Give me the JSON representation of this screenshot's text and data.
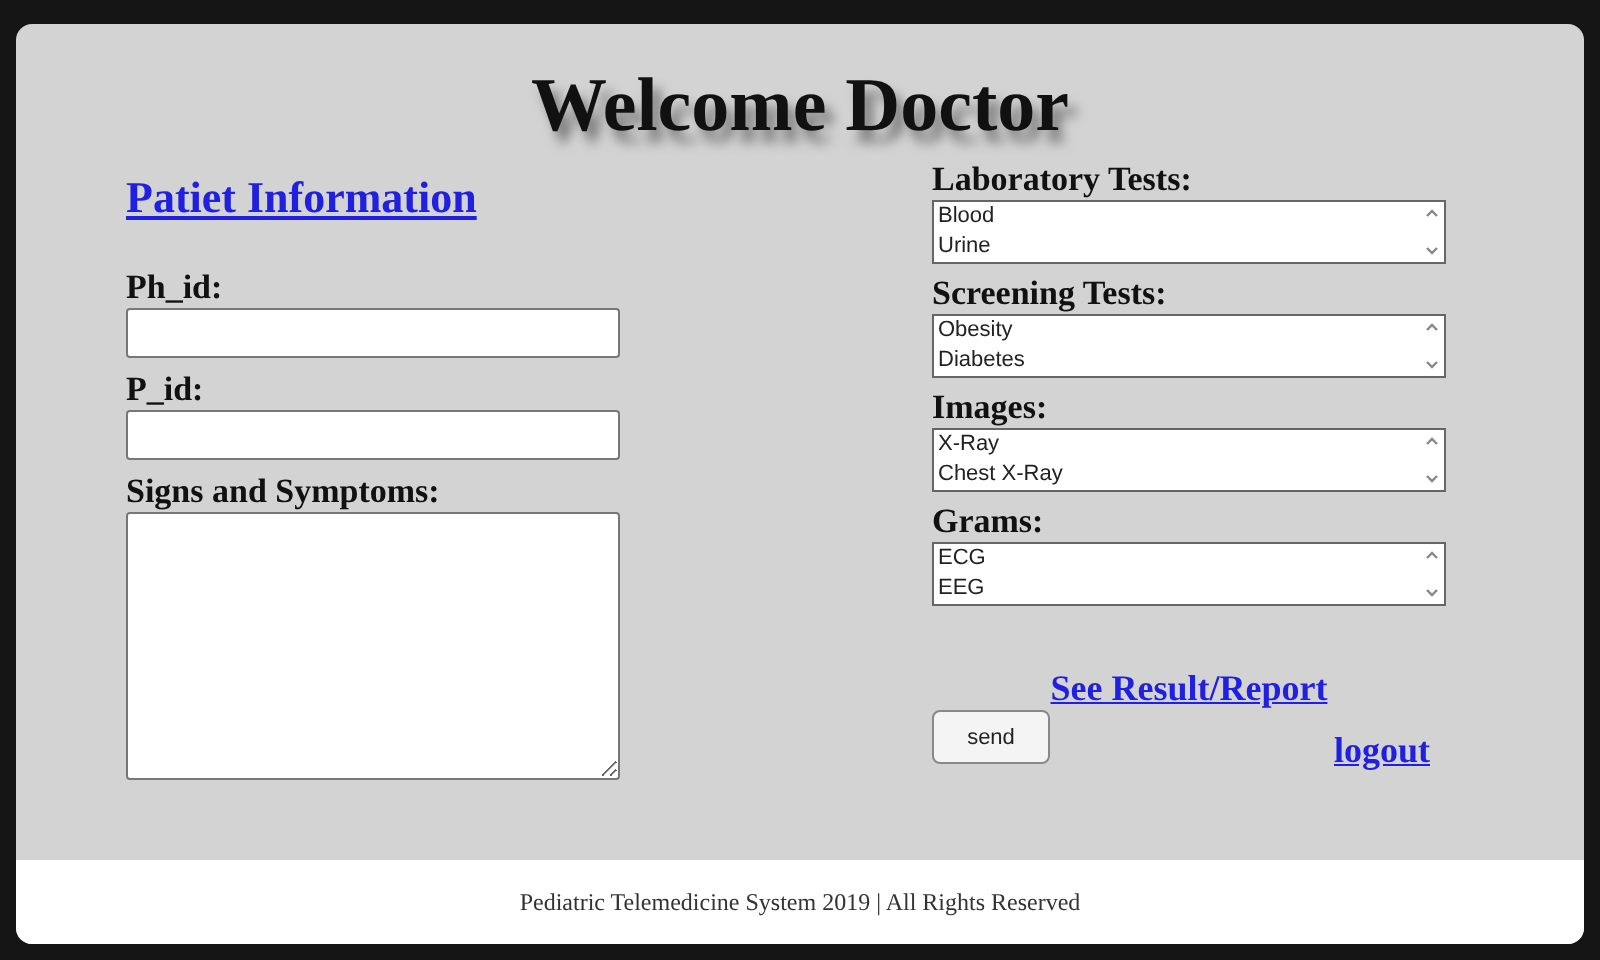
{
  "heading": "Welcome Doctor",
  "patient": {
    "link": "Patiet Information",
    "fields": [
      {
        "kind": "input",
        "label": "Ph_id:"
      },
      {
        "kind": "input",
        "label": "P_id:"
      },
      {
        "kind": "textarea",
        "label": "Signs and Symptoms:"
      }
    ]
  },
  "tests": [
    {
      "label": "Laboratory Tests:",
      "options": [
        "Blood",
        "Urine"
      ]
    },
    {
      "label": "Screening Tests:",
      "options": [
        "Obesity",
        "Diabetes"
      ]
    },
    {
      "label": "Images:",
      "options": [
        "X-Ray",
        "Chest X-Ray"
      ]
    },
    {
      "label": "Grams:",
      "options": [
        "ECG",
        "EEG"
      ]
    }
  ],
  "report_link": "See Result/Report",
  "send_button": "send",
  "logout_link": "logout",
  "footer": "Pediatric Telemedicine System 2019 | All Rights Reserved"
}
